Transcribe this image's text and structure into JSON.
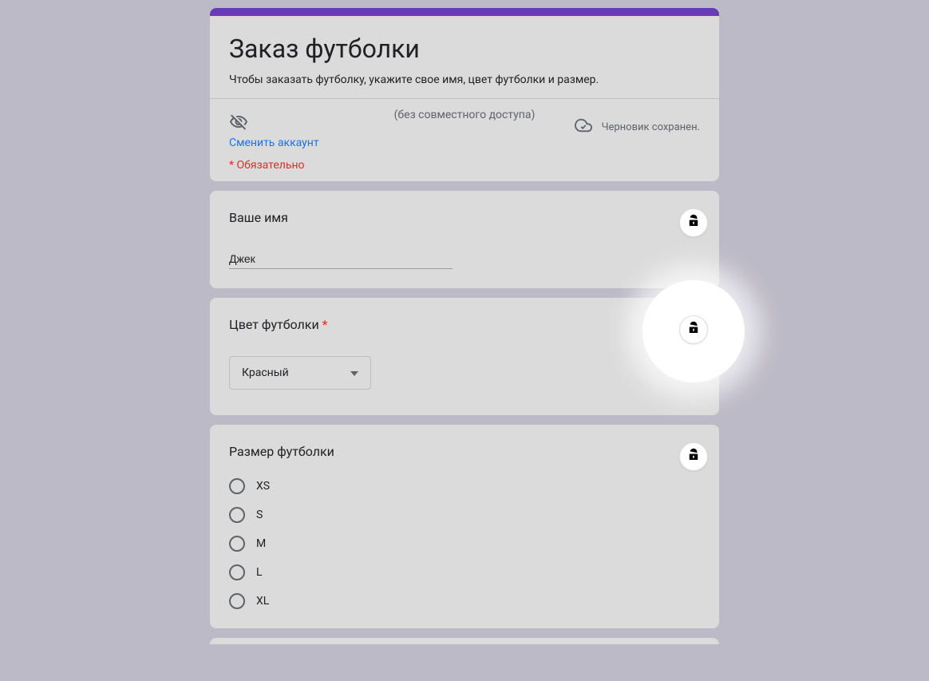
{
  "header": {
    "title": "Заказ футболки",
    "description": "Чтобы заказать футболку, укажите свое имя, цвет футболки и размер.",
    "no_share": "(без совместного доступа)",
    "switch_account": "Сменить аккаунт",
    "draft_saved": "Черновик сохранен.",
    "required_note": "* Обязательно"
  },
  "q_name": {
    "label": "Ваше имя",
    "value": "Джек"
  },
  "q_color": {
    "label": "Цвет футболки",
    "selected": "Красный"
  },
  "q_size": {
    "label": "Размер футболки",
    "options": [
      "XS",
      "S",
      "M",
      "L",
      "XL"
    ]
  }
}
